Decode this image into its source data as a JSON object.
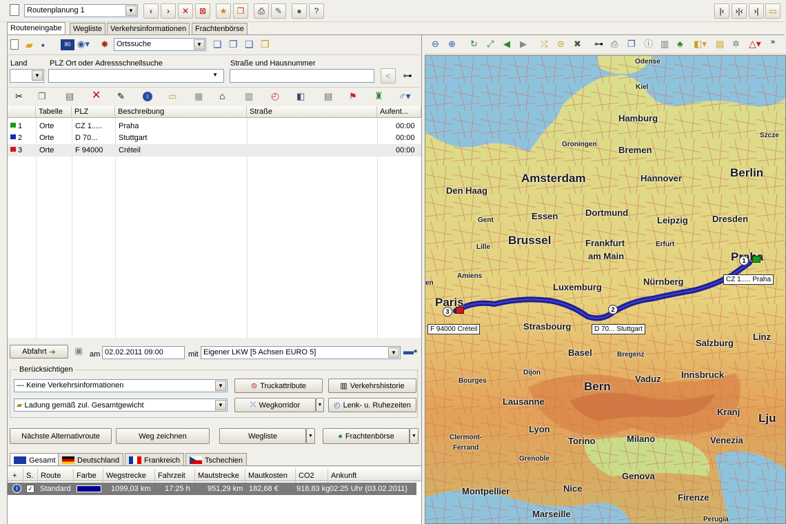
{
  "toolbar": {
    "route_select": "Routenplanung 1",
    "icons": [
      "prev-route-icon",
      "next-route-icon",
      "close-route-icon",
      "close-all-routes-icon",
      "open-folder-icon",
      "export-icon",
      "print-icon",
      "tools-icon",
      "globe-icon",
      "help-icon"
    ],
    "right_icons": [
      "first-icon",
      "split-icon",
      "last-icon",
      "window-icon"
    ]
  },
  "tabs": [
    "Routeneingabe",
    "Wegliste",
    "Verkehrsinformationen",
    "Frachtenbörse"
  ],
  "entry_toolbar": {
    "search_mode": "Ortssuche"
  },
  "address": {
    "land_label": "Land",
    "plz_label": "PLZ Ort oder Adressschnellsuche",
    "street_label": "Straße und Hausnummer",
    "land_value": "",
    "plz_value": "",
    "street_value": ""
  },
  "stops": {
    "headers": [
      "Tabelle",
      "PLZ",
      "Beschreibung",
      "Straße",
      "Aufent..."
    ],
    "rows": [
      {
        "num": "1",
        "flag": "#1a9a1a",
        "table": "Orte",
        "plz": "CZ 1.....",
        "desc": "Praha",
        "street": "",
        "stay": "00:00"
      },
      {
        "num": "2",
        "flag": "#1a2ea8",
        "table": "Orte",
        "plz": "D 70...",
        "desc": "Stuttgart",
        "street": "",
        "stay": "00:00"
      },
      {
        "num": "3",
        "flag": "#cc1a1a",
        "table": "Orte",
        "plz": "F 94000",
        "desc": "Créteil",
        "street": "",
        "stay": "00:00"
      }
    ]
  },
  "departure": {
    "button": "Abfahrt",
    "am": "am",
    "datetime": "02.02.2011  09:00",
    "mit": "mit",
    "vehicle": "Eigener LKW [5 Achsen EURO 5]"
  },
  "consider": {
    "title": "Berücksichtigen",
    "traffic": "Keine Verkehrsinformationen",
    "load": "Ladung gemäß zul. Gesamtgewicht",
    "truck_attr": "Truckattribute",
    "traffic_hist": "Verkehrshistorie",
    "corridor": "Wegkorridor",
    "driving_times": "Lenk- u. Ruhezeiten"
  },
  "actions": {
    "next_alt": "Nächste Alternativroute",
    "draw": "Weg zeichnen",
    "wegliste": "Wegliste",
    "freight": "Frachtenbörse"
  },
  "country_tabs": [
    {
      "label": "Gesamt",
      "icon": "eu-flag-icon"
    },
    {
      "label": "Deutschland",
      "icon": "germany-flag-icon"
    },
    {
      "label": "Frankreich",
      "icon": "france-flag-icon"
    },
    {
      "label": "Tschechien",
      "icon": "czech-flag-icon"
    }
  ],
  "summary": {
    "headers": [
      "+",
      "S.",
      "Route",
      "Farbe",
      "Wegstrecke",
      "Fahrzeit",
      "Mautstrecke",
      "Mautkosten",
      "CO2",
      "Ankunft"
    ],
    "row": {
      "route": "Standard",
      "distance": "1099,03 km",
      "time": "17:25 h",
      "toll_dist": "951,29 km",
      "toll_cost": "182,68 €",
      "co2": "918,83 kg",
      "arrival": "02:25 Uhr (03.02.2011)",
      "color": "#00008b"
    }
  },
  "map": {
    "cities": [
      {
        "name": "Odense",
        "size": "sm"
      },
      {
        "name": "Kiel",
        "size": "sm"
      },
      {
        "name": "Hamburg",
        "size": "mid"
      },
      {
        "name": "Groningen",
        "size": "sm"
      },
      {
        "name": "Bremen",
        "size": "mid"
      },
      {
        "name": "Szcze",
        "size": "sm"
      },
      {
        "name": "Amsterdam",
        "size": "big"
      },
      {
        "name": "Hannover",
        "size": "mid"
      },
      {
        "name": "Berlin",
        "size": "big"
      },
      {
        "name": "Den Haag",
        "size": "mid"
      },
      {
        "name": "Essen",
        "size": "mid"
      },
      {
        "name": "Dortmund",
        "size": "mid"
      },
      {
        "name": "Gent",
        "size": "sm"
      },
      {
        "name": "Leipzig",
        "size": "mid"
      },
      {
        "name": "Dresden",
        "size": "mid"
      },
      {
        "name": "Lille",
        "size": "sm"
      },
      {
        "name": "Brussel",
        "size": "big"
      },
      {
        "name": "Frankfurt",
        "size": "mid"
      },
      {
        "name": "am Main",
        "size": "mid"
      },
      {
        "name": "Erfurt",
        "size": "sm"
      },
      {
        "name": "Praha",
        "size": "big"
      },
      {
        "name": "Amiens",
        "size": "sm"
      },
      {
        "name": "Luxemburg",
        "size": "mid"
      },
      {
        "name": "Nürnberg",
        "size": "mid"
      },
      {
        "name": "Paris",
        "size": "big"
      },
      {
        "name": "Strasbourg",
        "size": "mid"
      },
      {
        "name": "Salzburg",
        "size": "mid"
      },
      {
        "name": "Linz",
        "size": "mid"
      },
      {
        "name": "Basel",
        "size": "mid"
      },
      {
        "name": "Bregenz",
        "size": "sm"
      },
      {
        "name": "Dijon",
        "size": "sm"
      },
      {
        "name": "Bourges",
        "size": "sm"
      },
      {
        "name": "Vaduz",
        "size": "mid"
      },
      {
        "name": "Innsbruck",
        "size": "mid"
      },
      {
        "name": "Bern",
        "size": "big"
      },
      {
        "name": "Lausanne",
        "size": "mid"
      },
      {
        "name": "Kranj",
        "size": "mid"
      },
      {
        "name": "Lju",
        "size": "big"
      },
      {
        "name": "Lyon",
        "size": "mid"
      },
      {
        "name": "Clermont-",
        "size": "sm"
      },
      {
        "name": "Ferrand",
        "size": "sm"
      },
      {
        "name": "Torino",
        "size": "mid"
      },
      {
        "name": "Milano",
        "size": "mid"
      },
      {
        "name": "Venezia",
        "size": "mid"
      },
      {
        "name": "Grenoble",
        "size": "sm"
      },
      {
        "name": "Genova",
        "size": "mid"
      },
      {
        "name": "Montpellier",
        "size": "mid"
      },
      {
        "name": "Nice",
        "size": "mid"
      },
      {
        "name": "Firenze",
        "size": "mid"
      },
      {
        "name": "Marseille",
        "size": "mid"
      },
      {
        "name": "Perugia",
        "size": "sm"
      },
      {
        "name": "en",
        "size": "sm"
      }
    ],
    "bubbles": [
      "CZ 1..... Praha",
      "D 70... Stuttgart",
      "F 94000 Créteil"
    ],
    "markers": [
      "1",
      "2",
      "3"
    ],
    "route_color": "#0a0a9a"
  }
}
